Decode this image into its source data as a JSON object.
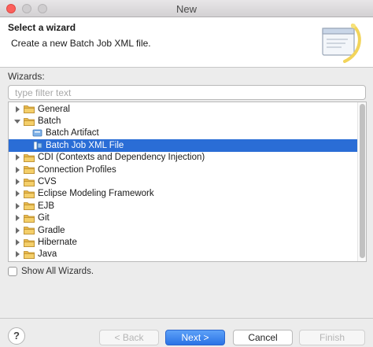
{
  "window": {
    "title": "New"
  },
  "header": {
    "title": "Select a wizard",
    "description": "Create a new Batch Job XML file."
  },
  "filter": {
    "label": "Wizards:",
    "placeholder": "type filter text",
    "value": ""
  },
  "tree": {
    "items": [
      {
        "label": "General",
        "type": "folder",
        "level": 0,
        "expanded": false,
        "selected": false
      },
      {
        "label": "Batch",
        "type": "folder",
        "level": 0,
        "expanded": true,
        "selected": false
      },
      {
        "label": "Batch Artifact",
        "type": "leaf",
        "icon": "batch-artifact-icon",
        "level": 1,
        "selected": false
      },
      {
        "label": "Batch Job XML File",
        "type": "leaf",
        "icon": "batch-job-xml-icon",
        "level": 1,
        "selected": true
      },
      {
        "label": "CDI (Contexts and Dependency Injection)",
        "type": "folder",
        "level": 0,
        "expanded": false,
        "selected": false
      },
      {
        "label": "Connection Profiles",
        "type": "folder",
        "level": 0,
        "expanded": false,
        "selected": false
      },
      {
        "label": "CVS",
        "type": "folder",
        "level": 0,
        "expanded": false,
        "selected": false
      },
      {
        "label": "Eclipse Modeling Framework",
        "type": "folder",
        "level": 0,
        "expanded": false,
        "selected": false
      },
      {
        "label": "EJB",
        "type": "folder",
        "level": 0,
        "expanded": false,
        "selected": false
      },
      {
        "label": "Git",
        "type": "folder",
        "level": 0,
        "expanded": false,
        "selected": false
      },
      {
        "label": "Gradle",
        "type": "folder",
        "level": 0,
        "expanded": false,
        "selected": false
      },
      {
        "label": "Hibernate",
        "type": "folder",
        "level": 0,
        "expanded": false,
        "selected": false
      },
      {
        "label": "Java",
        "type": "folder",
        "level": 0,
        "expanded": false,
        "selected": false
      }
    ]
  },
  "show_all": {
    "label": "Show All Wizards.",
    "checked": false
  },
  "footer": {
    "help_label": "?",
    "back_label": "< Back",
    "next_label": "Next >",
    "cancel_label": "Cancel",
    "finish_label": "Finish"
  },
  "colors": {
    "selection": "#2a6dd6",
    "folder": "#e8b84a",
    "primary_button": "#2a73e6"
  }
}
